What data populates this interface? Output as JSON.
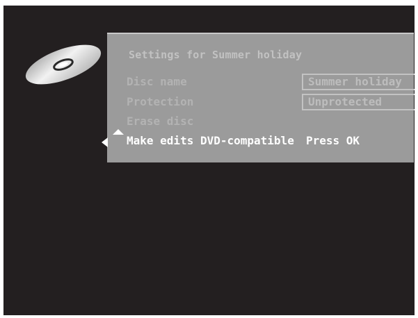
{
  "screen": {
    "background": "#231f20"
  },
  "disc": {
    "icon": "disc-icon"
  },
  "panel": {
    "title": "Settings for Summer holiday",
    "background": "#9b9b9b",
    "items": [
      {
        "label": "Disc name",
        "value": "Summer holiday",
        "state": "dim"
      },
      {
        "label": "Protection",
        "value": "Unprotected",
        "state": "dim"
      },
      {
        "label": "Erase disc",
        "state": "dim"
      },
      {
        "label": "Make edits DVD-compatible",
        "value": "Press OK",
        "state": "selected"
      }
    ]
  },
  "navigation": {
    "left_icon": "arrow-left-icon",
    "up_icon": "arrow-up-icon"
  }
}
